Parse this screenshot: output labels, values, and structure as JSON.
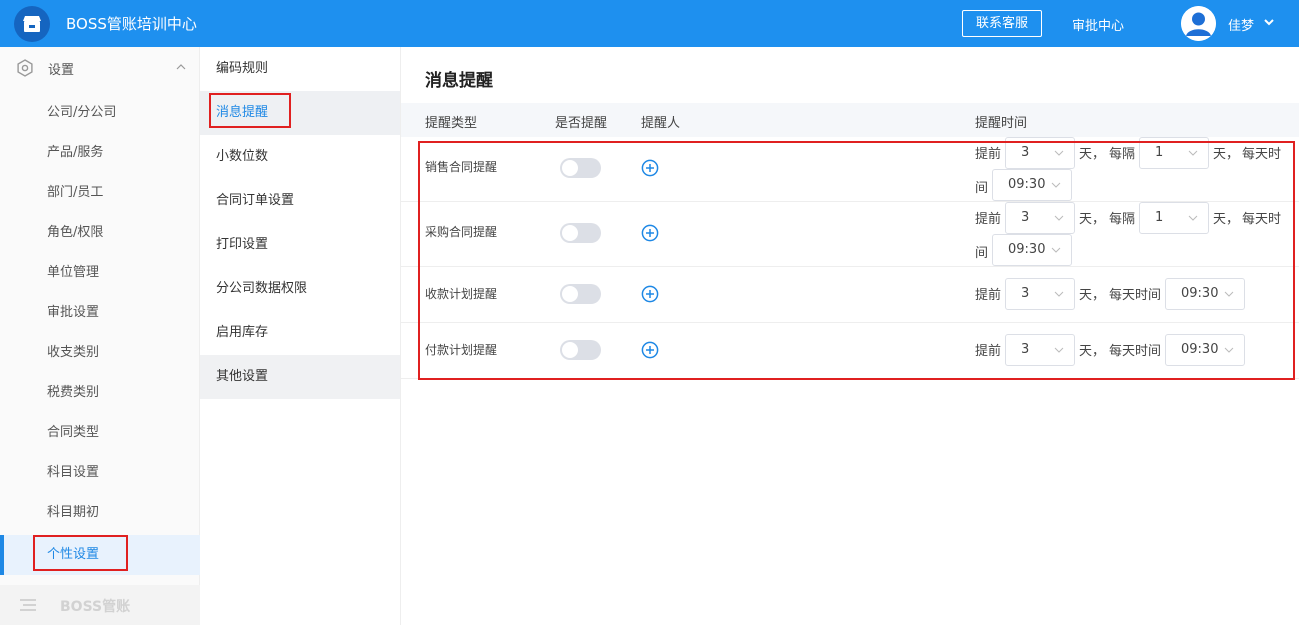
{
  "header": {
    "app_title": "BOSS管账培训中心",
    "contact_label": "联系客服",
    "approval_label": "审批中心",
    "user_name": "佳梦"
  },
  "sidebar": {
    "section_label": "设置",
    "items": [
      {
        "label": "公司/分公司"
      },
      {
        "label": "产品/服务"
      },
      {
        "label": "部门/员工"
      },
      {
        "label": "角色/权限"
      },
      {
        "label": "单位管理"
      },
      {
        "label": "审批设置"
      },
      {
        "label": "收支类别"
      },
      {
        "label": "税费类别"
      },
      {
        "label": "合同类型"
      },
      {
        "label": "科目设置"
      },
      {
        "label": "科目期初"
      },
      {
        "label": "个性设置"
      }
    ],
    "bottom_label": "BOSS管账"
  },
  "subnav": {
    "items": [
      {
        "label": "编码规则"
      },
      {
        "label": "消息提醒"
      },
      {
        "label": "小数位数"
      },
      {
        "label": "合同订单设置"
      },
      {
        "label": "打印设置"
      },
      {
        "label": "分公司数据权限"
      },
      {
        "label": "启用库存"
      },
      {
        "label": "其他设置"
      }
    ]
  },
  "main": {
    "title": "消息提醒",
    "columns": {
      "type": "提醒类型",
      "enabled": "是否提醒",
      "person": "提醒人",
      "time": "提醒时间"
    },
    "rows": [
      {
        "label": "销售合同提醒",
        "before_label": "提前",
        "before_days": "3",
        "day_unit": "天，",
        "interval_label": "每隔",
        "interval": "1",
        "interval_unit": "天，",
        "daily_label": "每天时",
        "daily_label_cont": "间",
        "time": "09:30"
      },
      {
        "label": "采购合同提醒",
        "before_label": "提前",
        "before_days": "3",
        "day_unit": "天，",
        "interval_label": "每隔",
        "interval": "1",
        "interval_unit": "天，",
        "daily_label": "每天时",
        "daily_label_cont": "间",
        "time": "09:30"
      },
      {
        "label": "收款计划提醒",
        "before_label": "提前",
        "before_days": "3",
        "day_unit": "天，",
        "daily_label": "每天时间",
        "time": "09:30"
      },
      {
        "label": "付款计划提醒",
        "before_label": "提前",
        "before_days": "3",
        "day_unit": "天，",
        "daily_label": "每天时间",
        "time": "09:30"
      }
    ]
  },
  "colors": {
    "primary": "#1e90ef",
    "active_text": "#1e88e5",
    "highlight": "#e02020"
  }
}
